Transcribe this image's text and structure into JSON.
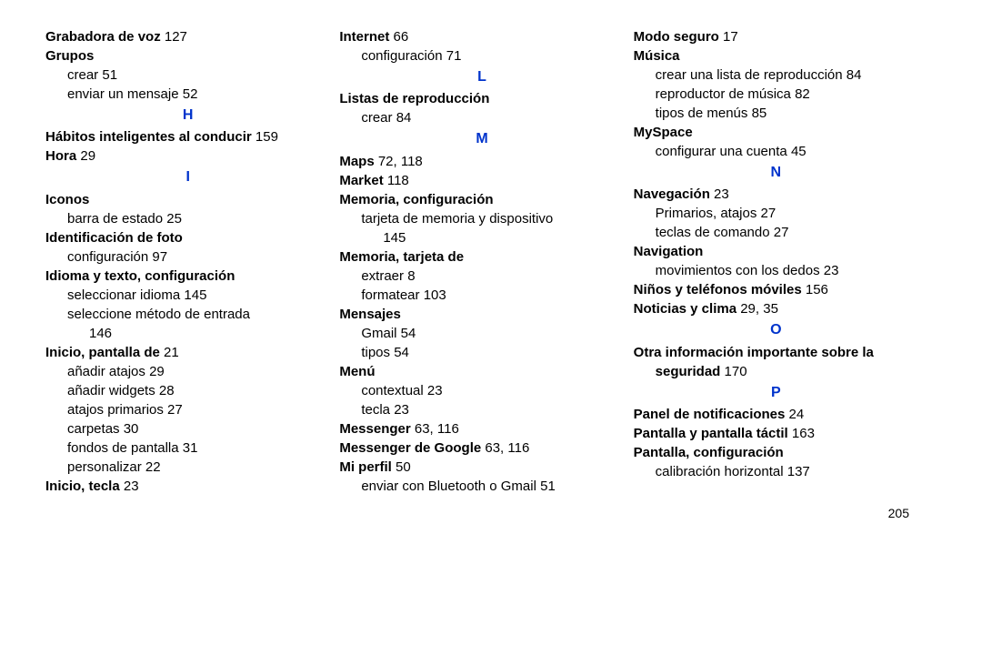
{
  "page_number": "205",
  "col1": {
    "e0": {
      "t": "Grabadora de voz",
      "p": "127"
    },
    "e1": {
      "t": "Grupos"
    },
    "e1a": {
      "t": "crear",
      "p": "51"
    },
    "e1b": {
      "t": "enviar un mensaje",
      "p": "52"
    },
    "L_H": "H",
    "e2": {
      "t": "Hábitos inteligentes al conducir",
      "p": "159"
    },
    "e3": {
      "t": "Hora",
      "p": "29"
    },
    "L_I": "I",
    "e4": {
      "t": "Iconos"
    },
    "e4a": {
      "t": "barra de estado",
      "p": "25"
    },
    "e5": {
      "t": "Identificación de foto"
    },
    "e5a": {
      "t": "configuración",
      "p": "97"
    },
    "e6": {
      "t": "Idioma y texto, configuración"
    },
    "e6a": {
      "t": "seleccionar idioma",
      "p": "145"
    },
    "e6b": {
      "t": "seleccione método de entrada"
    },
    "e6b2": {
      "p": "146"
    },
    "e7": {
      "t": "Inicio, pantalla de",
      "p": "21"
    },
    "e7a": {
      "t": "añadir atajos",
      "p": "29"
    },
    "e7b": {
      "t": "añadir widgets",
      "p": "28"
    },
    "e7c": {
      "t": "atajos primarios",
      "p": "27"
    },
    "e7d": {
      "t": "carpetas",
      "p": "30"
    },
    "e7e": {
      "t": "fondos de pantalla",
      "p": "31"
    },
    "e7f": {
      "t": "personalizar",
      "p": "22"
    },
    "e8": {
      "t": "Inicio, tecla",
      "p": "23"
    }
  },
  "col2": {
    "e0": {
      "t": "Internet",
      "p": "66"
    },
    "e0a": {
      "t": "configuración",
      "p": "71"
    },
    "L_L": "L",
    "e1": {
      "t": "Listas de reproducción"
    },
    "e1a": {
      "t": "crear",
      "p": "84"
    },
    "L_M": "M",
    "e2": {
      "t": "Maps",
      "p": "72, 118"
    },
    "e3": {
      "t": "Market",
      "p": "118"
    },
    "e4": {
      "t": "Memoria, configuración"
    },
    "e4a": {
      "t": "tarjeta de memoria y dispositivo"
    },
    "e4a2": {
      "p": "145"
    },
    "e5": {
      "t": "Memoria, tarjeta de"
    },
    "e5a": {
      "t": "extraer",
      "p": "8"
    },
    "e5b": {
      "t": "formatear",
      "p": "103"
    },
    "e6": {
      "t": "Mensajes"
    },
    "e6a": {
      "t": "Gmail",
      "p": "54"
    },
    "e6b": {
      "t": "tipos",
      "p": "54"
    },
    "e7": {
      "t": "Menú"
    },
    "e7a": {
      "t": "contextual",
      "p": "23"
    },
    "e7b": {
      "t": "tecla",
      "p": "23"
    },
    "e8": {
      "t": "Messenger",
      "p": "63, 116"
    },
    "e9": {
      "t": "Messenger de Google",
      "p": "63, 116"
    },
    "e10": {
      "t": "Mi perfil",
      "p": "50"
    },
    "e10a": {
      "t": "enviar con Bluetooth o Gmail",
      "p": "51"
    }
  },
  "col3": {
    "e0": {
      "t": "Modo seguro",
      "p": "17"
    },
    "e1": {
      "t": "Música"
    },
    "e1a": {
      "t": "crear una lista de reproducción",
      "p": "84"
    },
    "e1b": {
      "t": "reproductor de música",
      "p": "82"
    },
    "e1c": {
      "t": "tipos de menús",
      "p": "85"
    },
    "e2": {
      "t": "MySpace"
    },
    "e2a": {
      "t": "configurar una cuenta",
      "p": "45"
    },
    "L_N": "N",
    "e3": {
      "t": "Navegación",
      "p": "23"
    },
    "e3a": {
      "t": "Primarios, atajos",
      "p": "27"
    },
    "e3b": {
      "t": "teclas de comando",
      "p": "27"
    },
    "e4": {
      "t": "Navigation"
    },
    "e4a": {
      "t": "movimientos con los dedos",
      "p": "23"
    },
    "e5": {
      "t": "Niños y teléfonos móviles",
      "p": "156"
    },
    "e6": {
      "t": "Noticias y clima",
      "p": "29, 35"
    },
    "L_O": "O",
    "e7": {
      "t": "Otra información importante sobre la"
    },
    "e7b": {
      "t": "seguridad",
      "p": "170"
    },
    "L_P": "P",
    "e8": {
      "t": "Panel de notificaciones",
      "p": "24"
    },
    "e9": {
      "t": "Pantalla y pantalla táctil",
      "p": "163"
    },
    "e10": {
      "t": "Pantalla, configuración"
    },
    "e10a": {
      "t": "calibración horizontal",
      "p": "137"
    }
  }
}
